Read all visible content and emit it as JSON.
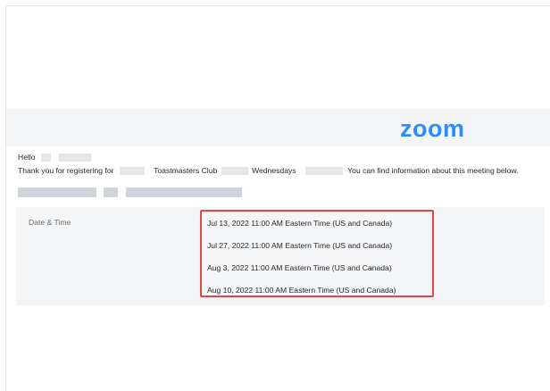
{
  "brand": {
    "logo_text": "zoom",
    "accent": "#2d8cff"
  },
  "message": {
    "greeting": "Hello",
    "thanks_prefix": "Thank you for registering for",
    "club_text": "Toastmasters Club",
    "day_text": "Wednesdays",
    "info_text": "You can find information about this meeting below."
  },
  "meeting": {
    "date_time_label": "Date & Time",
    "occurrences": [
      "Jul 13, 2022 11:00 AM Eastern Time (US and Canada)",
      "Jul 27, 2022 11:00 AM Eastern Time (US and Canada)",
      "Aug 3, 2022 11:00 AM Eastern Time (US and Canada)",
      "Aug 10, 2022 11:00 AM Eastern Time (US and Canada)"
    ],
    "highlight_color": "#e04848"
  }
}
